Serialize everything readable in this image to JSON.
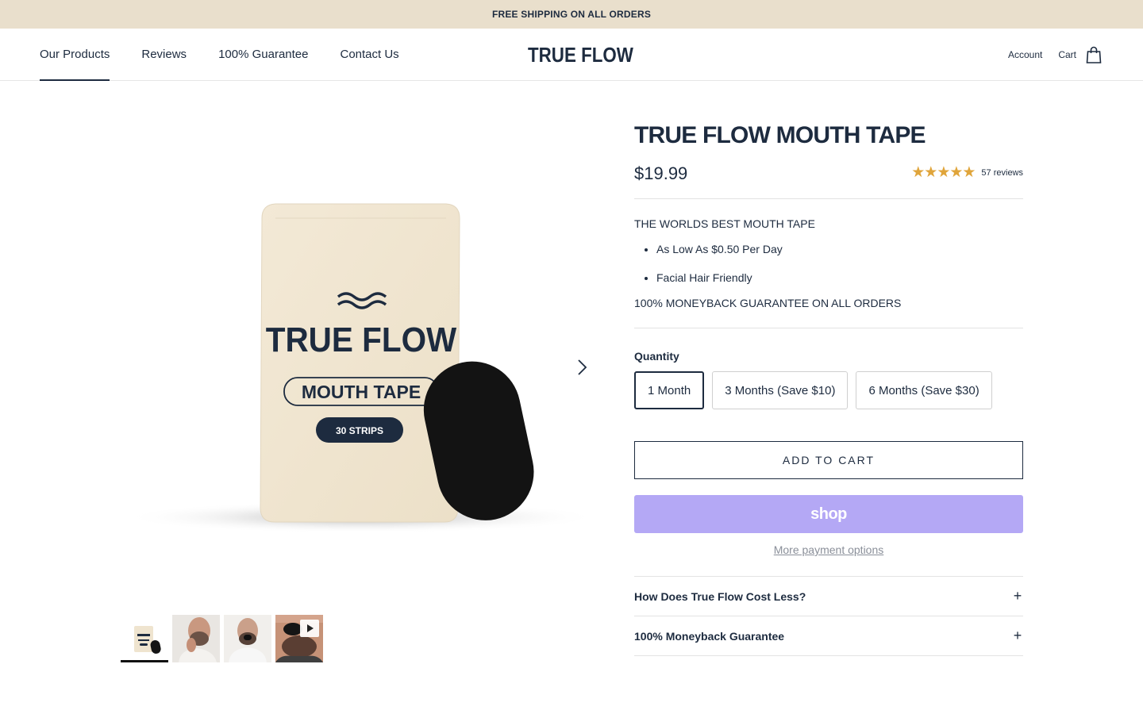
{
  "announcement": "FREE SHIPPING ON ALL ORDERS",
  "nav": {
    "items": [
      "Our Products",
      "Reviews",
      "100% Guarantee",
      "Contact Us"
    ],
    "active": "Our Products"
  },
  "logo": "TRUE FLOW",
  "header_right": {
    "account": "Account",
    "cart": "Cart"
  },
  "gallery": {
    "package": {
      "brand": "TRUE FLOW",
      "product": "MOUTH TAPE",
      "count": "30 STRIPS"
    },
    "next_icon": "chevron-right-icon",
    "thumbnails": [
      {
        "name": "thumb-package",
        "active": true
      },
      {
        "name": "thumb-man-touching-lips",
        "active": false
      },
      {
        "name": "thumb-man-wearing-tape",
        "active": false
      },
      {
        "name": "thumb-video",
        "active": false,
        "icon": "play-icon"
      }
    ]
  },
  "product": {
    "title": "TRUE FLOW MOUTH TAPE",
    "price": "$19.99",
    "rating": 5,
    "stars": "★★★★★",
    "review_count": "57 reviews",
    "description": {
      "headline": "THE WORLDS BEST MOUTH TAPE",
      "bullets": [
        "As Low As $0.50 Per Day",
        "Facial Hair Friendly"
      ],
      "guarantee": "100% MONEYBACK GUARANTEE ON ALL ORDERS"
    },
    "quantity_label": "Quantity",
    "quantity_options": [
      "1 Month",
      "3 Months (Save $10)",
      "6 Months (Save $30)"
    ],
    "quantity_selected": "1 Month",
    "add_to_cart": "ADD TO CART",
    "shop_pay": "shop",
    "more_payment": "More payment options",
    "accordion": [
      {
        "title": "How Does True Flow Cost Less?",
        "icon": "plus-icon"
      },
      {
        "title": "100% Moneyback Guarantee",
        "icon": "plus-icon"
      }
    ]
  },
  "colors": {
    "navy": "#1d2b3f",
    "announcement_bg": "#e9dfcc",
    "star": "#e0a53b",
    "shop_pay": "#b4a8f5"
  }
}
